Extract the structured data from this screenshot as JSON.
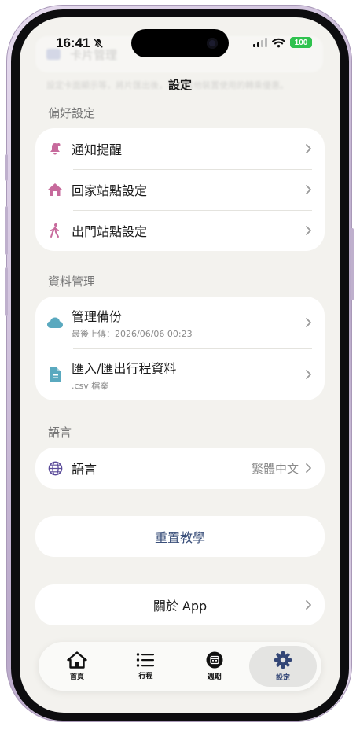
{
  "status_bar": {
    "time": "16:41",
    "battery": "100"
  },
  "nav": {
    "title": "設定"
  },
  "background": {
    "card_title": "卡片管理",
    "hint": "設定卡面顯示等，將片匯出後，可在其他裝置使用的轉乘優惠。"
  },
  "sections": {
    "preferences": {
      "header": "偏好設定",
      "items": [
        {
          "label": "通知提醒",
          "icon": "bell-icon"
        },
        {
          "label": "回家站點設定",
          "icon": "home-icon"
        },
        {
          "label": "出門站點設定",
          "icon": "walking-icon"
        }
      ]
    },
    "data_management": {
      "header": "資料管理",
      "items": [
        {
          "label": "管理備份",
          "subtitle": "最後上傳：2026/06/06 00:23",
          "icon": "cloud-icon"
        },
        {
          "label": "匯入/匯出行程資料",
          "subtitle": ".csv 檔案",
          "icon": "document-icon"
        }
      ]
    },
    "language": {
      "header": "語言",
      "items": [
        {
          "label": "語言",
          "value": "繁體中文",
          "icon": "globe-icon"
        }
      ]
    }
  },
  "actions": {
    "reset_tutorial": "重置教學",
    "about": "關於 App"
  },
  "tab_bar": {
    "tabs": [
      {
        "label": "首頁",
        "icon": "house-icon"
      },
      {
        "label": "行程",
        "icon": "list-icon"
      },
      {
        "label": "週期",
        "icon": "calendar-icon"
      },
      {
        "label": "設定",
        "icon": "gear-icon",
        "active": true
      }
    ]
  },
  "colors": {
    "background": "#f3f2ee",
    "card": "#ffffff",
    "accent_pink": "#c76a9c",
    "accent_teal": "#5aa9bf",
    "accent_purple": "#5b4b9a",
    "accent_navy": "#3a4f7a",
    "battery_green": "#2fc24e"
  }
}
